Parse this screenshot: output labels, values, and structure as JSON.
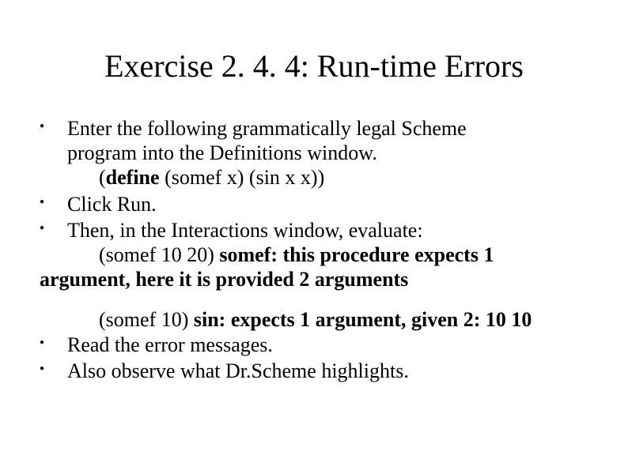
{
  "title": "Exercise 2. 4. 4: Run-time Errors",
  "items": {
    "i1_line1": "Enter the following grammatically legal Scheme",
    "i1_line2": "program into the Definitions window.",
    "i1_code_pre": "(",
    "i1_code_kw": "define",
    "i1_code_post": " (somef x) (sin x x))",
    "i2": "Click Run.",
    "i3_line1": "Then, in the Interactions window, evaluate:",
    "i3_sub_plain": "(somef 10 20) ",
    "i3_sub_bold1": "somef: this procedure expects 1",
    "i3_sub_bold2": "argument, here it is provided 2 arguments",
    "i3b_plain": "(somef 10) ",
    "i3b_bold": "sin: expects 1 argument, given 2: 10 10",
    "i4": "Read the error messages.",
    "i5": "Also observe what Dr.Scheme highlights."
  }
}
